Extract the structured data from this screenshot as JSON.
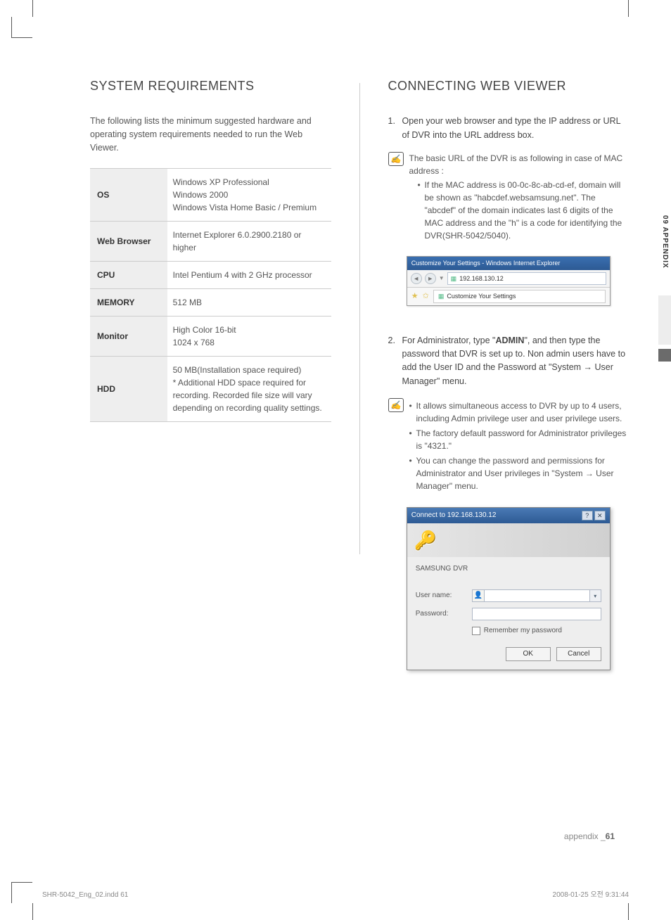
{
  "left": {
    "heading": "SYSTEM REQUIREMENTS",
    "intro": "The following lists the minimum suggested hardware and operating system requirements needed to run the Web Viewer.",
    "rows": [
      {
        "label": "OS",
        "value": "Windows XP Professional\nWindows 2000\nWindows Vista Home Basic / Premium"
      },
      {
        "label": "Web Browser",
        "value": "Internet Explorer 6.0.2900.2180 or higher"
      },
      {
        "label": "CPU",
        "value": "Intel Pentium 4 with 2 GHz processor"
      },
      {
        "label": "MEMORY",
        "value": "512 MB"
      },
      {
        "label": "Monitor",
        "value": "High Color 16-bit\n1024 x 768"
      },
      {
        "label": "HDD",
        "value": "50 MB(Installation space required)\n* Additional HDD space required for recording. Recorded file size will vary depending on recording quality settings."
      }
    ]
  },
  "right": {
    "heading": "CONNECTING WEB VIEWER",
    "step1": "Open your web browser and type the IP address or URL of DVR into the URL address box.",
    "note1_lead": "The basic URL of the DVR is as following in case of MAC address :",
    "note1_bullet": "If the MAC address is 00-0c-8c-ab-cd-ef, domain will be shown as \"habcdef.websamsung.net\". The \"abcdef\" of the domain indicates last 6 digits of the MAC address and the \"h\" is a code for identifying the DVR(SHR-5042/5040).",
    "browser": {
      "title": "Customize Your Settings - Windows Internet Explorer",
      "address": "192.168.130.12",
      "tab": "Customize Your Settings"
    },
    "step2_pre": "For Administrator, type \"",
    "step2_admin": "ADMIN",
    "step2_post": "\", and then type the password that DVR is set up to. Non admin users have to add the User ID and the Password at \"System → User Manager\" menu.",
    "note2_bullets": [
      "It allows simultaneous access to DVR by up to 4 users, including Admin privilege user and user privilege users.",
      "The factory default password for Administrator privileges is \"4321.\"",
      "You can change the password and permissions for Administrator and User privileges in \"System → User Manager\" menu."
    ],
    "login": {
      "title": "Connect to 192.168.130.12",
      "realm": "SAMSUNG DVR",
      "user_label": "User name:",
      "pass_label": "Password:",
      "remember": "Remember my password",
      "ok": "OK",
      "cancel": "Cancel"
    }
  },
  "side_label": "09 APPENDIX",
  "footer_right_label": "appendix _",
  "footer_right_page": "61",
  "print_left": "SHR-5042_Eng_02.indd   61",
  "print_right": "2008-01-25   오전 9:31:44"
}
